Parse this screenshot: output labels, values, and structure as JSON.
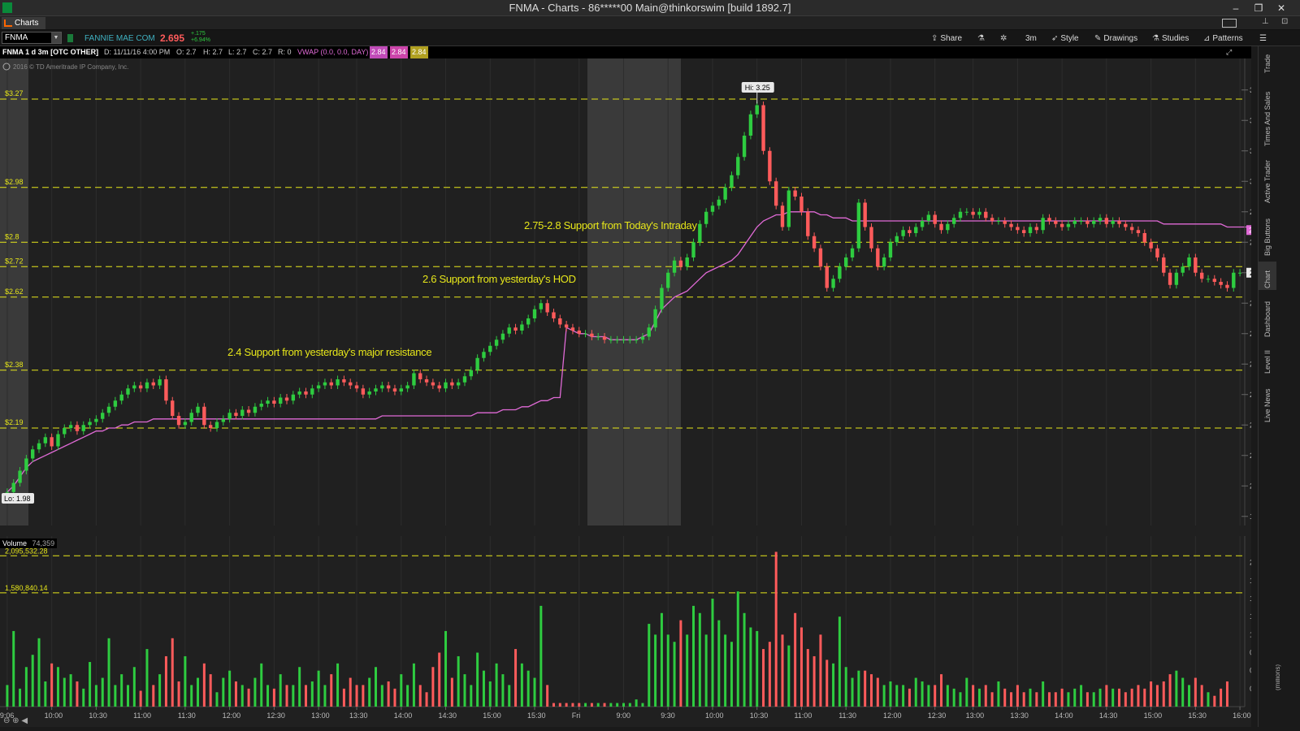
{
  "window": {
    "title": "FNMA - Charts - 86*****00 Main@thinkorswim [build 1892.7]",
    "min": "–",
    "restore": "❐",
    "close": "✕"
  },
  "tab": {
    "label": "Charts"
  },
  "toolbar": {
    "symbol": "FNMA",
    "company": "FANNIE MAE COM",
    "price": "2.695",
    "change": "+.175",
    "change_pct": "+6.94%",
    "share": "Share",
    "aggregation": "3m",
    "style": "Style",
    "drawings": "Drawings",
    "studies": "Studies",
    "patterns": "Patterns"
  },
  "infobar": {
    "title": "FNMA 1 d 3m [OTC OTHER]",
    "date": "D: 11/11/16 4:00 PM",
    "open": "O: 2.7",
    "high": "H: 2.7",
    "low": "L: 2.7",
    "close": "C: 2.7",
    "range": "R: 0",
    "vwap": "VWAP (0.0, 0.0, DAY)",
    "v1": "2.84",
    "v2": "2.84",
    "v3": "2.84"
  },
  "copyright": "2016 © TD Ameritrade IP Company, Inc.",
  "hline_labels": [
    "$3.27",
    "$2.98",
    "$2.8",
    "$2.72",
    "$2.62",
    "$2.38",
    "$2.19"
  ],
  "annotations": [
    "2.75-2.8 Support from Today's Intraday",
    "2.6 Support from yesterday's HOD",
    "2.4 Support from yesterday's major resistance"
  ],
  "hi_bubble": "Hi: 3.25",
  "lo_bubble": "Lo: 1.98",
  "vwap_tag": "2.84",
  "last_tag": "2.7",
  "colors": {
    "up": "#2ecc40",
    "down": "#ff5b5b",
    "vwap": "#e06ad6",
    "hline": "#e6e61a",
    "bg": "#202020"
  },
  "volume": {
    "label": "Volume",
    "value": "74,359",
    "line1": "2,095,532.28",
    "line2": "1,580,840.14",
    "unit": "(millions)"
  },
  "right_tabs": [
    "Trade",
    "Times And Sales",
    "Active Trader",
    "Big Buttons",
    "Chart",
    "Dashboard",
    "Level II",
    "Live News"
  ],
  "chart_data": {
    "type": "candlestick",
    "symbol": "FNMA",
    "y_ticks": [
      "3.3",
      "3.2",
      "3.1",
      "3",
      "2.9",
      "2.8",
      "2.7",
      "2.6",
      "2.5",
      "2.4",
      "2.3",
      "2.2",
      "2.1",
      "2",
      "1.9"
    ],
    "ylim": [
      1.87,
      3.35
    ],
    "x_ticks": [
      "9:06",
      "10:00",
      "10:30",
      "11:00",
      "11:30",
      "12:00",
      "12:30",
      "13:00",
      "13:30",
      "14:00",
      "14:30",
      "15:00",
      "15:30",
      "Fri",
      "9:00",
      "9:30",
      "10:00",
      "10:30",
      "11:00",
      "11:30",
      "12:00",
      "12:30",
      "13:00",
      "13:30",
      "14:00",
      "14:30",
      "15:00",
      "15:30",
      "16:00"
    ],
    "vol_ticks": [
      "2",
      "1.75",
      "1.5",
      "1.25",
      "1",
      "0.75",
      "0.5",
      "0.25"
    ],
    "vol_ylim": [
      0,
      2.2
    ],
    "horizontal_lines": [
      3.27,
      2.98,
      2.8,
      2.72,
      2.62,
      2.38,
      2.19
    ],
    "volume_lines": [
      2.0955,
      1.5808
    ],
    "high": 3.25,
    "low": 1.98,
    "close": [
      1.98,
      2.01,
      2.05,
      2.09,
      2.12,
      2.14,
      2.16,
      2.13,
      2.17,
      2.19,
      2.2,
      2.18,
      2.2,
      2.21,
      2.22,
      2.24,
      2.26,
      2.28,
      2.3,
      2.32,
      2.33,
      2.32,
      2.34,
      2.33,
      2.35,
      2.28,
      2.23,
      2.2,
      2.21,
      2.24,
      2.26,
      2.2,
      2.19,
      2.21,
      2.22,
      2.24,
      2.23,
      2.25,
      2.24,
      2.26,
      2.27,
      2.28,
      2.27,
      2.29,
      2.28,
      2.3,
      2.31,
      2.3,
      2.32,
      2.33,
      2.34,
      2.33,
      2.35,
      2.34,
      2.33,
      2.32,
      2.3,
      2.31,
      2.32,
      2.33,
      2.32,
      2.31,
      2.32,
      2.33,
      2.37,
      2.35,
      2.34,
      2.33,
      2.32,
      2.34,
      2.33,
      2.34,
      2.36,
      2.38,
      2.42,
      2.44,
      2.46,
      2.48,
      2.5,
      2.52,
      2.51,
      2.53,
      2.55,
      2.58,
      2.6,
      2.57,
      2.55,
      2.53,
      2.52,
      2.51,
      2.5,
      2.5,
      2.49,
      2.49,
      2.48,
      2.48,
      2.48,
      2.48,
      2.48,
      2.48,
      2.49,
      2.52,
      2.58,
      2.65,
      2.7,
      2.74,
      2.72,
      2.75,
      2.8,
      2.86,
      2.9,
      2.92,
      2.94,
      2.98,
      3.02,
      3.08,
      3.15,
      3.22,
      3.25,
      3.1,
      3.0,
      2.92,
      2.85,
      2.97,
      2.95,
      2.9,
      2.82,
      2.78,
      2.72,
      2.65,
      2.68,
      2.72,
      2.75,
      2.78,
      2.93,
      2.85,
      2.78,
      2.72,
      2.75,
      2.8,
      2.82,
      2.84,
      2.83,
      2.85,
      2.87,
      2.89,
      2.86,
      2.84,
      2.86,
      2.88,
      2.9,
      2.9,
      2.89,
      2.9,
      2.88,
      2.87,
      2.87,
      2.86,
      2.85,
      2.84,
      2.83,
      2.85,
      2.84,
      2.88,
      2.87,
      2.86,
      2.85,
      2.86,
      2.87,
      2.87,
      2.86,
      2.87,
      2.88,
      2.86,
      2.87,
      2.86,
      2.85,
      2.84,
      2.83,
      2.8,
      2.78,
      2.75,
      2.7,
      2.66,
      2.7,
      2.72,
      2.75,
      2.7,
      2.68,
      2.68,
      2.67,
      2.66,
      2.65,
      2.7,
      2.7
    ],
    "vwap": [
      1.98,
      2.0,
      2.03,
      2.06,
      2.08,
      2.09,
      2.1,
      2.11,
      2.12,
      2.13,
      2.14,
      2.15,
      2.16,
      2.17,
      2.18,
      2.18,
      2.19,
      2.19,
      2.2,
      2.2,
      2.21,
      2.21,
      2.21,
      2.22,
      2.22,
      2.22,
      2.22,
      2.22,
      2.22,
      2.22,
      2.22,
      2.22,
      2.22,
      2.22,
      2.22,
      2.22,
      2.22,
      2.22,
      2.22,
      2.22,
      2.22,
      2.22,
      2.22,
      2.22,
      2.22,
      2.22,
      2.22,
      2.22,
      2.22,
      2.22,
      2.22,
      2.22,
      2.22,
      2.22,
      2.22,
      2.22,
      2.22,
      2.22,
      2.22,
      2.23,
      2.23,
      2.23,
      2.23,
      2.23,
      2.23,
      2.23,
      2.23,
      2.23,
      2.23,
      2.23,
      2.23,
      2.23,
      2.23,
      2.23,
      2.24,
      2.24,
      2.24,
      2.24,
      2.25,
      2.25,
      2.25,
      2.26,
      2.26,
      2.27,
      2.28,
      2.28,
      2.29,
      2.29,
      2.52,
      2.51,
      2.5,
      2.5,
      2.49,
      2.49,
      2.49,
      2.48,
      2.48,
      2.48,
      2.48,
      2.48,
      2.49,
      2.5,
      2.54,
      2.58,
      2.6,
      2.62,
      2.63,
      2.64,
      2.66,
      2.68,
      2.7,
      2.71,
      2.72,
      2.73,
      2.74,
      2.76,
      2.79,
      2.82,
      2.85,
      2.87,
      2.88,
      2.89,
      2.89,
      2.9,
      2.9,
      2.9,
      2.9,
      2.9,
      2.89,
      2.89,
      2.88,
      2.88,
      2.88,
      2.87,
      2.87,
      2.87,
      2.87,
      2.87,
      2.87,
      2.87,
      2.87,
      2.87,
      2.87,
      2.87,
      2.87,
      2.87,
      2.87,
      2.87,
      2.87,
      2.87,
      2.87,
      2.87,
      2.87,
      2.87,
      2.87,
      2.87,
      2.87,
      2.87,
      2.87,
      2.87,
      2.87,
      2.87,
      2.87,
      2.87,
      2.87,
      2.87,
      2.87,
      2.87,
      2.87,
      2.87,
      2.87,
      2.87,
      2.87,
      2.87,
      2.87,
      2.87,
      2.87,
      2.87,
      2.87,
      2.87,
      2.87,
      2.87,
      2.86,
      2.86,
      2.86,
      2.86,
      2.86,
      2.86,
      2.86,
      2.86,
      2.86,
      2.86,
      2.85,
      2.85,
      2.85,
      2.85,
      2.84
    ],
    "volume_millions": [
      0.3,
      1.05,
      0.25,
      0.55,
      0.72,
      0.95,
      0.35,
      0.6,
      0.55,
      0.4,
      0.45,
      0.35,
      0.25,
      0.62,
      0.3,
      0.4,
      0.95,
      0.3,
      0.45,
      0.3,
      0.55,
      0.22,
      0.8,
      0.3,
      0.45,
      0.7,
      0.95,
      0.35,
      0.7,
      0.3,
      0.4,
      0.6,
      0.45,
      0.2,
      0.4,
      0.5,
      0.35,
      0.3,
      0.25,
      0.4,
      0.6,
      0.3,
      0.25,
      0.45,
      0.3,
      0.3,
      0.55,
      0.3,
      0.35,
      0.5,
      0.3,
      0.45,
      0.6,
      0.25,
      0.4,
      0.3,
      0.3,
      0.4,
      0.55,
      0.3,
      0.35,
      0.25,
      0.45,
      0.3,
      0.6,
      0.3,
      0.2,
      0.55,
      0.75,
      1.05,
      0.4,
      0.7,
      0.45,
      0.3,
      0.75,
      0.5,
      0.35,
      0.6,
      0.45,
      0.3,
      0.8,
      0.6,
      0.5,
      0.4,
      1.4,
      0.3,
      0.05,
      0.05,
      0.05,
      0.05,
      0.05,
      0.05,
      0.05,
      0.05,
      0.05,
      0.05,
      0.05,
      0.05,
      0.05,
      0.1,
      0.05,
      1.15,
      1.0,
      1.3,
      1.0,
      0.9,
      1.2,
      1.0,
      1.4,
      1.3,
      1.0,
      1.5,
      1.2,
      1.0,
      0.9,
      1.6,
      1.3,
      1.1,
      1.05,
      0.8,
      0.9,
      2.15,
      1.0,
      0.85,
      1.3,
      1.1,
      0.8,
      0.7,
      1.0,
      0.65,
      0.6,
      1.25,
      0.55,
      0.4,
      0.5,
      0.5,
      0.45,
      0.4,
      0.3,
      0.35,
      0.3,
      0.3,
      0.25,
      0.4,
      0.35,
      0.3,
      0.3,
      0.45,
      0.3,
      0.25,
      0.2,
      0.4,
      0.3,
      0.25,
      0.3,
      0.2,
      0.35,
      0.25,
      0.2,
      0.3,
      0.2,
      0.25,
      0.2,
      0.35,
      0.2,
      0.2,
      0.25,
      0.2,
      0.25,
      0.3,
      0.2,
      0.2,
      0.25,
      0.3,
      0.25,
      0.25,
      0.2,
      0.25,
      0.3,
      0.25,
      0.35,
      0.3,
      0.35,
      0.45,
      0.5,
      0.4,
      0.3,
      0.4,
      0.3,
      0.2,
      0.15,
      0.25,
      0.35
    ]
  }
}
